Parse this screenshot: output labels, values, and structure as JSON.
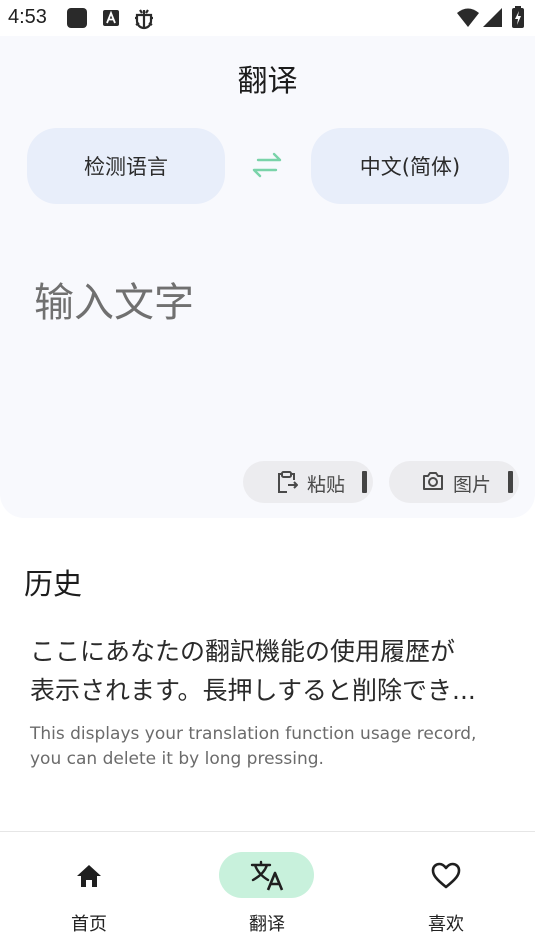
{
  "status_bar": {
    "time": "4:53",
    "icons": [
      "square-notification-icon",
      "font-a-icon",
      "bug-icon",
      "wifi-icon",
      "signal-icon",
      "battery-charging-icon"
    ]
  },
  "header": {
    "title": "翻译"
  },
  "languages": {
    "source": "检测语言",
    "target": "中文(简体)",
    "swap_icon": "swap-arrows-icon"
  },
  "input": {
    "placeholder": "输入文字"
  },
  "actions": {
    "paste_label": "粘贴",
    "image_label": "图片"
  },
  "history": {
    "title": "历史",
    "ja_line1": "ここにあなたの翻訳機能の使用履歴が",
    "ja_line2": "表示されます。長押しすると削除でき...",
    "en_text": "This displays your translation function usage record, you can delete it by long pressing."
  },
  "bottom_nav": {
    "items": [
      {
        "label": "首页",
        "icon": "home-icon",
        "active": false
      },
      {
        "label": "翻译",
        "icon": "translate-icon",
        "active": true
      },
      {
        "label": "喜欢",
        "icon": "heart-icon",
        "active": false
      }
    ]
  },
  "colors": {
    "panel_bg": "#f8f9fd",
    "lang_button_bg": "#e8eefa",
    "swap_icon": "#7ad3a9",
    "active_nav_pill": "#c8f1dc"
  }
}
